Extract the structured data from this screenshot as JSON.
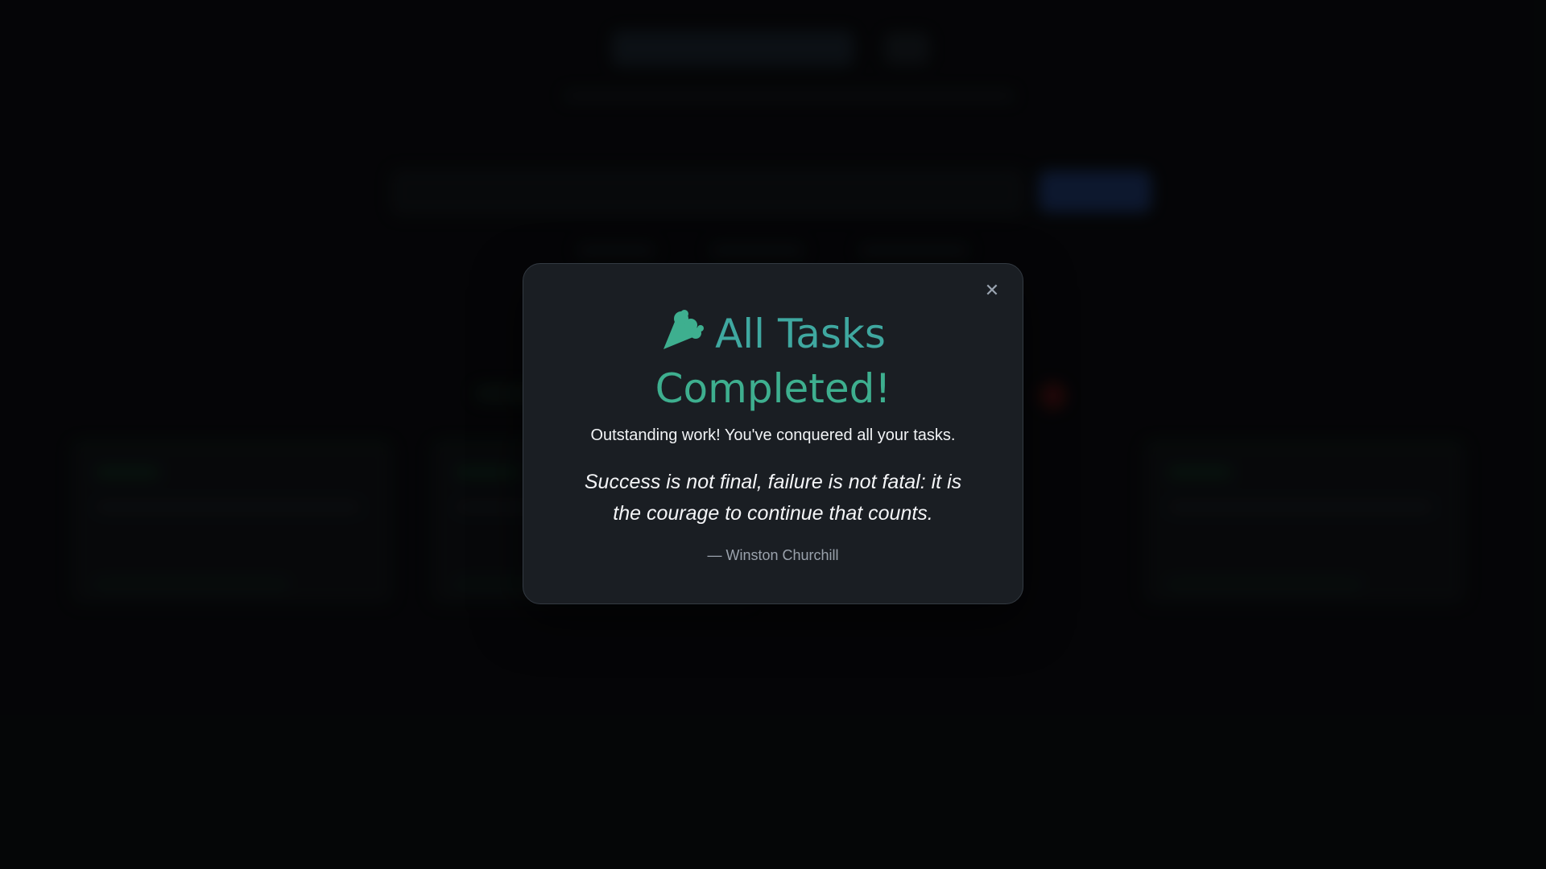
{
  "modal": {
    "icon": "party-popper-icon",
    "title_line1": "All Tasks",
    "title_line2": "Completed!",
    "message": "Outstanding work! You've conquered all your tasks.",
    "quote": "Success is not final, failure is not fatal: it is the courage to continue that counts.",
    "author": "— Winston Churchill",
    "close_label": "✕"
  },
  "colors": {
    "accent_teal": "#3fa8a0",
    "accent_green": "#3eaf8f",
    "modal_bg": "#1a1e23",
    "page_bg": "#08090b"
  }
}
